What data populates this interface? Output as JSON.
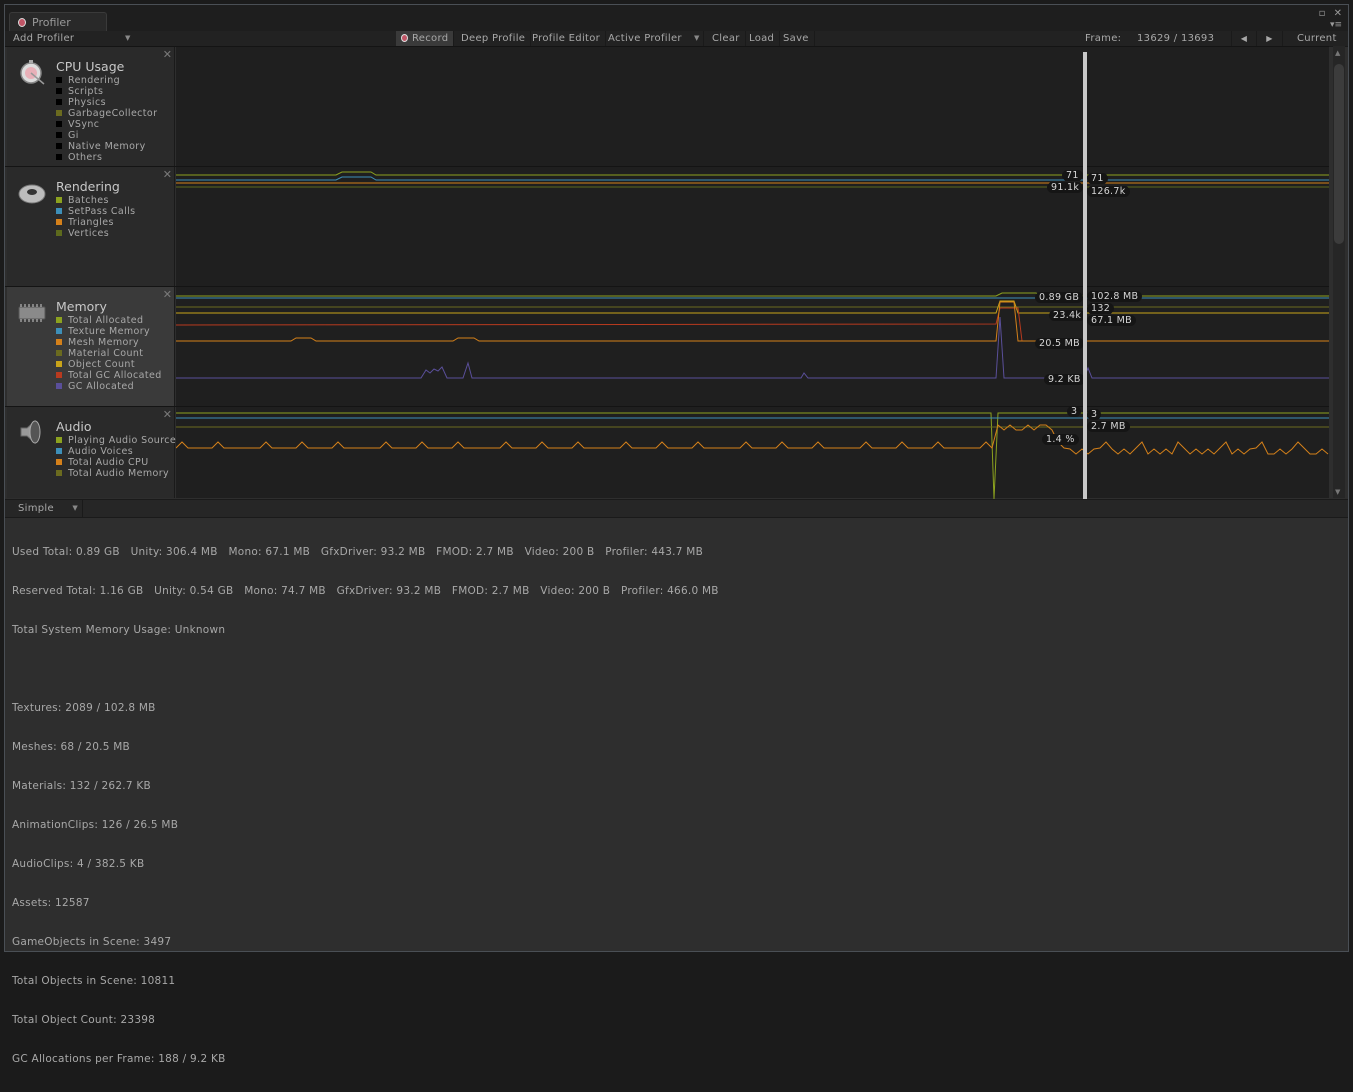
{
  "window": {
    "tab_title": "Profiler",
    "controls": [
      "maximize-icon",
      "close-icon"
    ],
    "menu_icon": "context-menu-icon"
  },
  "toolbar": {
    "add_profiler": "Add Profiler",
    "record": "Record",
    "deep_profile": "Deep Profile",
    "profile_editor": "Profile Editor",
    "active_profiler": "Active Profiler",
    "clear": "Clear",
    "load": "Load",
    "save": "Save",
    "frame_label": "Frame:",
    "frame_value": "13629 / 13693",
    "prev_frame": "◀",
    "next_frame": "▶",
    "current": "Current"
  },
  "panels": [
    {
      "title": "CPU Usage",
      "icon": "stopwatch-icon",
      "items": [
        {
          "label": "Rendering",
          "color": "#000000"
        },
        {
          "label": "Scripts",
          "color": "#000000"
        },
        {
          "label": "Physics",
          "color": "#000000"
        },
        {
          "label": "GarbageCollector",
          "color": "#6b6b1f"
        },
        {
          "label": "VSync",
          "color": "#000000"
        },
        {
          "label": "Gi",
          "color": "#000000"
        },
        {
          "label": "Native Memory",
          "color": "#000000"
        },
        {
          "label": "Others",
          "color": "#000000"
        }
      ],
      "values": []
    },
    {
      "title": "Rendering",
      "icon": "torus-icon",
      "items": [
        {
          "label": "Batches",
          "color": "#8ca21f"
        },
        {
          "label": "SetPass Calls",
          "color": "#3d8fb8"
        },
        {
          "label": "Triangles",
          "color": "#d4801a"
        },
        {
          "label": "Vertices",
          "color": "#5d6a1d"
        }
      ],
      "values": {
        "left": [
          "71",
          "91.1k"
        ],
        "right": [
          "71",
          "126.7k"
        ]
      }
    },
    {
      "title": "Memory",
      "icon": "memory-chip-icon",
      "items": [
        {
          "label": "Total Allocated",
          "color": "#8ca21f"
        },
        {
          "label": "Texture Memory",
          "color": "#3d8fb8"
        },
        {
          "label": "Mesh Memory",
          "color": "#d4801a"
        },
        {
          "label": "Material Count",
          "color": "#6b6b1f"
        },
        {
          "label": "Object Count",
          "color": "#c9a41a"
        },
        {
          "label": "Total GC Allocated",
          "color": "#b83a1f"
        },
        {
          "label": "GC Allocated",
          "color": "#5a4f9a"
        }
      ],
      "values": {
        "left": [
          "0.89 GB",
          "23.4k",
          "20.5 MB",
          "9.2 KB"
        ],
        "right": [
          "102.8 MB",
          "132",
          "67.1 MB"
        ]
      }
    },
    {
      "title": "Audio",
      "icon": "speaker-icon",
      "items": [
        {
          "label": "Playing Audio Sources",
          "color": "#8ca21f"
        },
        {
          "label": "Audio Voices",
          "color": "#3d8fb8"
        },
        {
          "label": "Total Audio CPU",
          "color": "#d4801a"
        },
        {
          "label": "Total Audio Memory",
          "color": "#6b6b1f"
        }
      ],
      "values": {
        "left": [
          "3",
          "1.4 %"
        ],
        "right": [
          "3",
          "2.7 MB"
        ]
      }
    }
  ],
  "detail": {
    "mode": "Simple",
    "lines": [
      "Used Total: 0.89 GB   Unity: 306.4 MB   Mono: 67.1 MB   GfxDriver: 93.2 MB   FMOD: 2.7 MB   Video: 200 B   Profiler: 443.7 MB",
      "Reserved Total: 1.16 GB   Unity: 0.54 GB   Mono: 74.7 MB   GfxDriver: 93.2 MB   FMOD: 2.7 MB   Video: 200 B   Profiler: 466.0 MB",
      "Total System Memory Usage: Unknown",
      "",
      "Textures: 2089 / 102.8 MB",
      "Meshes: 68 / 20.5 MB",
      "Materials: 132 / 262.7 KB",
      "AnimationClips: 126 / 26.5 MB",
      "AudioClips: 4 / 382.5 KB",
      "Assets: 12587",
      "GameObjects in Scene: 3497",
      "Total Objects in Scene: 10811",
      "Total Object Count: 23398",
      "GC Allocations per Frame: 188 / 9.2 KB"
    ]
  },
  "frame": {
    "current": 13629,
    "total": 13693
  }
}
